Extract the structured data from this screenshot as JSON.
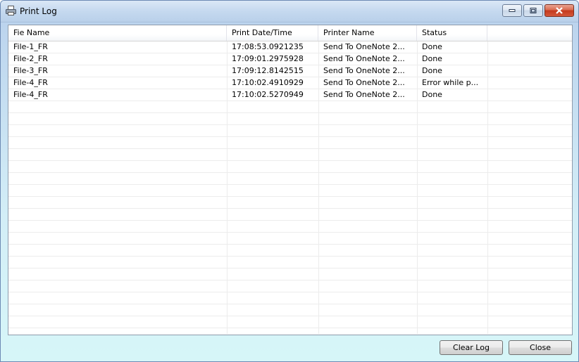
{
  "window": {
    "title": "Print Log",
    "icon": "printer-icon"
  },
  "columns": [
    "Fie Name",
    "Print Date/Time",
    "Printer Name",
    "Status",
    ""
  ],
  "rows": [
    [
      "File-1_FR",
      "17:08:53.0921235",
      "Send To OneNote 2...",
      "Done"
    ],
    [
      "File-2_FR",
      "17:09:01.2975928",
      "Send To OneNote 2...",
      "Done"
    ],
    [
      "File-3_FR",
      "17:09:12.8142515",
      "Send To OneNote 2...",
      "Done"
    ],
    [
      "File-4_FR",
      "17:10:02.4910929",
      "Send To OneNote 2...",
      "Error while p..."
    ],
    [
      "File-4_FR",
      "17:10:02.5270949",
      "Send To OneNote 2...",
      "Done"
    ]
  ],
  "buttons": {
    "clear_log": "Clear Log",
    "close": "Close"
  },
  "colors": {
    "window_frame": "#6d8ab4",
    "close_button": "#c4391c"
  }
}
